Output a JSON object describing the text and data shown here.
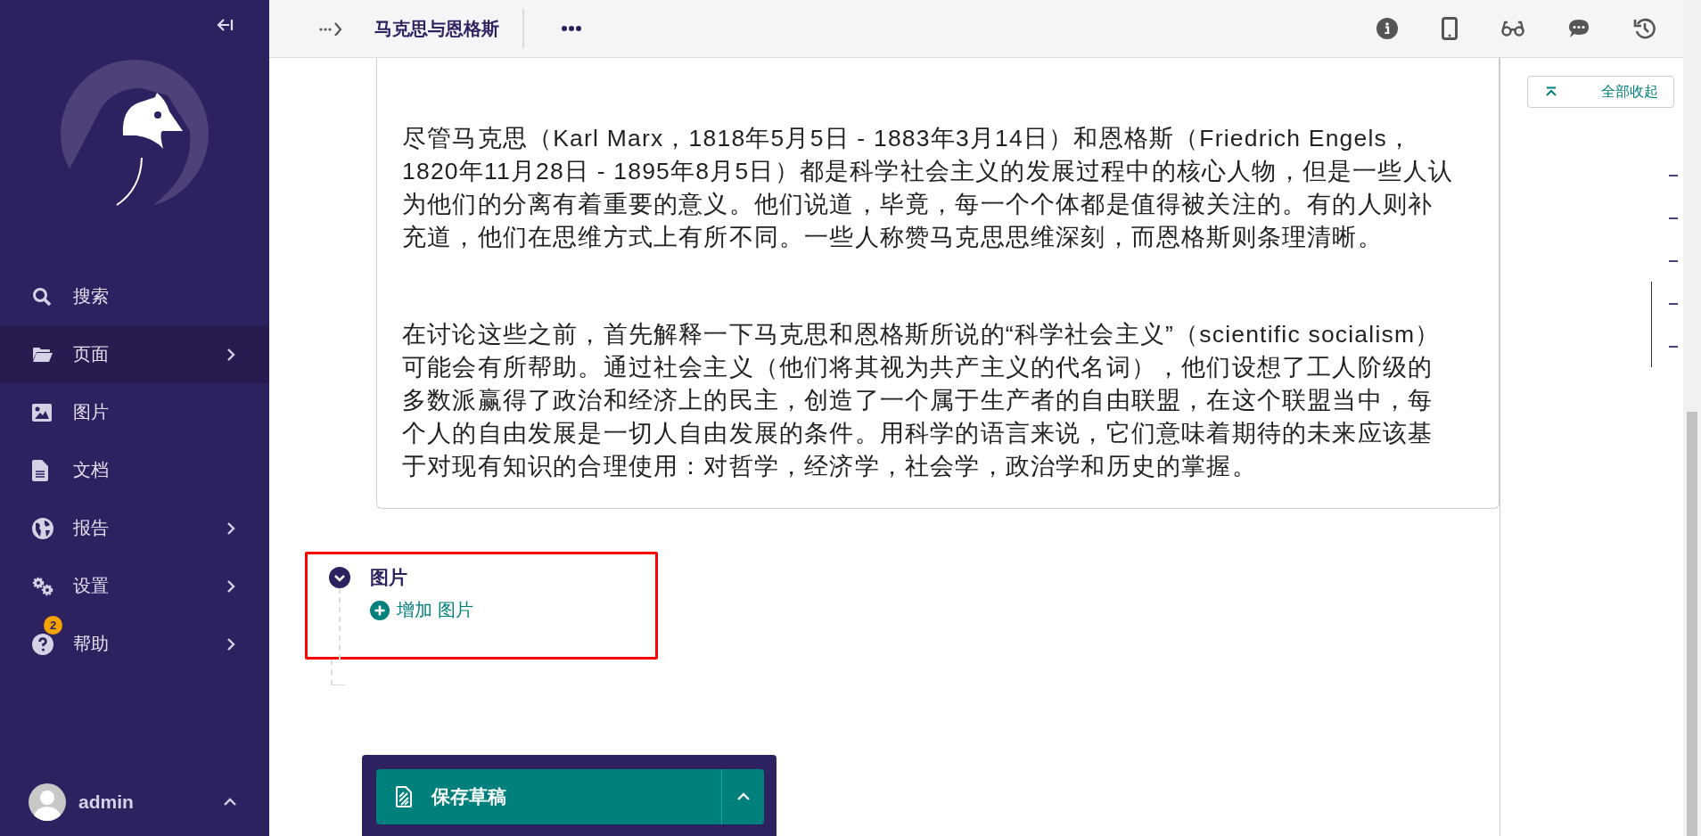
{
  "sidebar": {
    "items": [
      {
        "label": "搜索",
        "selected": false,
        "has_submenu": false
      },
      {
        "label": "页面",
        "selected": true,
        "has_submenu": true
      },
      {
        "label": "图片",
        "selected": false,
        "has_submenu": false
      },
      {
        "label": "文档",
        "selected": false,
        "has_submenu": false
      },
      {
        "label": "报告",
        "selected": false,
        "has_submenu": true
      },
      {
        "label": "设置",
        "selected": false,
        "has_submenu": true
      },
      {
        "label": "帮助",
        "selected": false,
        "has_submenu": true,
        "badge": "2"
      }
    ],
    "user": {
      "name": "admin"
    }
  },
  "topbar": {
    "title": "马克思与恩格斯"
  },
  "content": {
    "paragraphs": [
      "尽管马克思（Karl Marx，1818年5月5日 - 1883年3月14日）和恩格斯（Friedrich Engels，1820年11月28日 - 1895年8月5日）都是科学社会主义的发展过程中的核心人物，但是一些人认为他们的分离有着重要的意义。他们说道，毕竟，每一个个体都是值得被关注的。有的人则补充道，他们在思维方式上有所不同。一些人称赞马克思思维深刻，而恩格斯则条理清晰。",
      "在讨论这些之前，首先解释一下马克思和恩格斯所说的“科学社会主义”（scientific socialism）可能会有所帮助。通过社会主义（他们将其视为共产主义的代名词），他们设想了工人阶级的多数派赢得了政治和经济上的民主，创造了一个属于生产者的自由联盟，在这个联盟当中，每个人的自由发展是一切人自由发展的条件。用科学的语言来说，它们意味着期待的未来应该基于对现有知识的合理使用：对哲学，经济学，社会学，政治学和历史的掌握。"
    ]
  },
  "section": {
    "title": "图片",
    "expanded": true,
    "add_link": "增加 图片"
  },
  "outline": {
    "collapse_all": "全部收起"
  },
  "save": {
    "label": "保存草稿"
  }
}
